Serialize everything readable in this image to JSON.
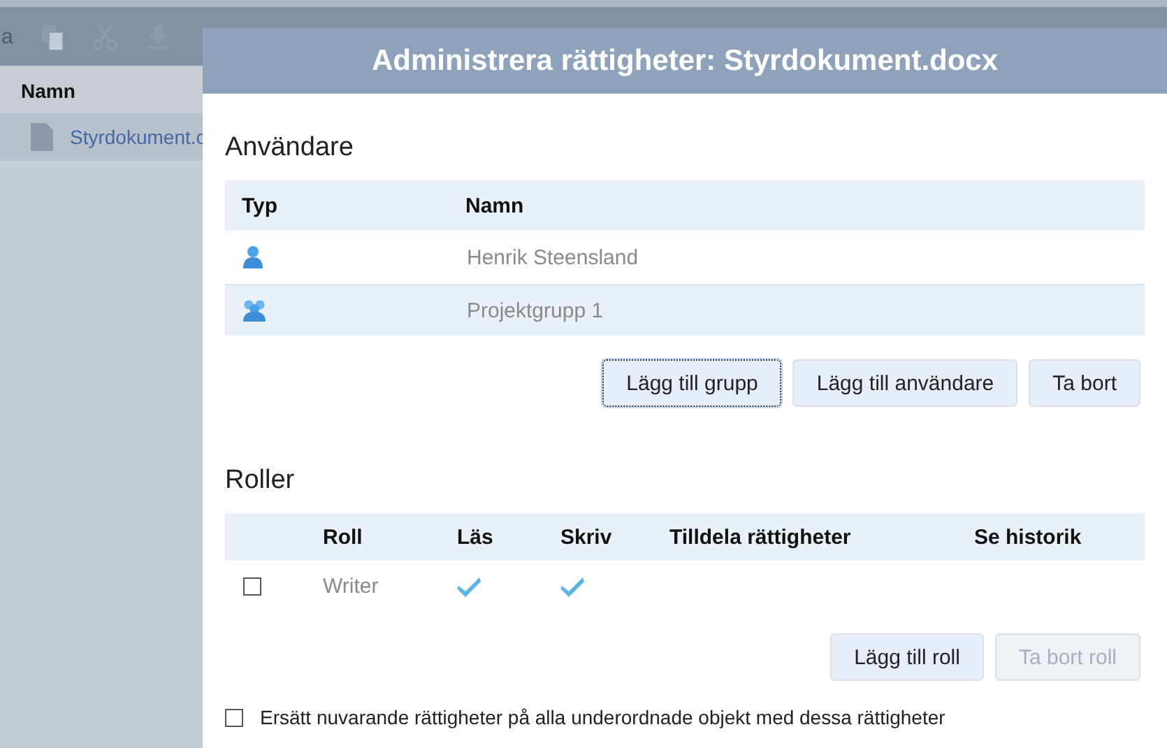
{
  "background": {
    "toolbar_text": "a",
    "list_header": "Namn",
    "files": [
      {
        "name": "Styrdokument.c",
        "selected": true
      }
    ]
  },
  "dialog": {
    "title": "Administrera rättigheter: Styrdokument.docx",
    "users": {
      "heading": "Användare",
      "columns": [
        "Typ",
        "Namn"
      ],
      "rows": [
        {
          "kind": "user",
          "name": "Henrik Steensland",
          "selected": false
        },
        {
          "kind": "group",
          "name": "Projektgrupp 1",
          "selected": true
        }
      ],
      "buttons": [
        {
          "label": "Lägg till grupp",
          "focused": true,
          "disabled": false
        },
        {
          "label": "Lägg till användare",
          "focused": false,
          "disabled": false
        },
        {
          "label": "Ta bort",
          "focused": false,
          "disabled": false
        }
      ]
    },
    "roles": {
      "heading": "Roller",
      "columns": [
        "Roll",
        "Läs",
        "Skriv",
        "Tilldela rättigheter",
        "Se historik"
      ],
      "rows": [
        {
          "checked": false,
          "name": "Writer",
          "read": true,
          "write": true
        }
      ],
      "buttons": [
        {
          "label": "Lägg till roll",
          "focused": false,
          "disabled": false
        },
        {
          "label": "Ta bort roll",
          "focused": false,
          "disabled": true
        }
      ]
    },
    "replace": {
      "label": "Ersätt nuvarande rättigheter på alla underordnade objekt med dessa rättigheter",
      "checked": false
    }
  }
}
